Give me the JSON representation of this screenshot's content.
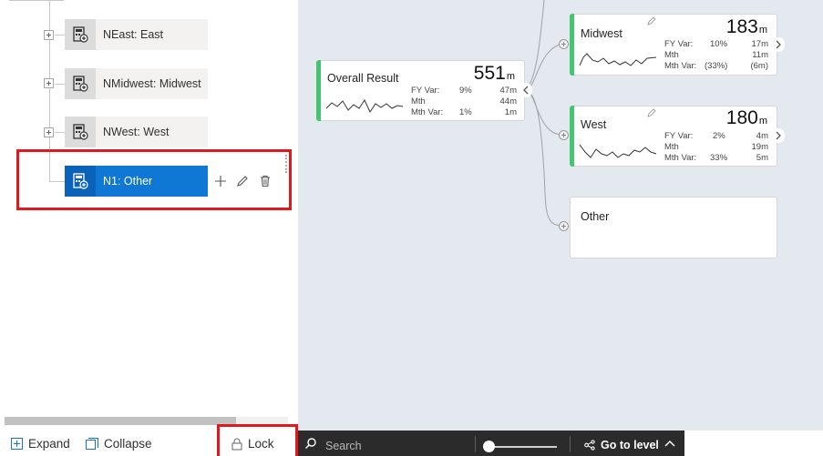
{
  "tree": {
    "nodes": [
      {
        "label": "NEast: East"
      },
      {
        "label": "NMidwest: Midwest"
      },
      {
        "label": "NWest: West"
      },
      {
        "label": "N1: Other",
        "selected": true
      }
    ],
    "actions": {
      "add": "add-icon",
      "edit": "pencil-icon",
      "delete": "trash-icon"
    }
  },
  "bottom": {
    "expand_label": "Expand",
    "collapse_label": "Collapse",
    "lock_label": "Lock"
  },
  "cards": {
    "overall": {
      "title": "Overall Result",
      "total": "551",
      "unit": "m",
      "rows": [
        {
          "label": "FY Var:",
          "pct": "9%",
          "val": "47m"
        },
        {
          "label": "Mth",
          "pct": "",
          "val": "44m"
        },
        {
          "label": "Mth Var:",
          "pct": "1%",
          "val": "1m"
        }
      ]
    },
    "midwest": {
      "title": "Midwest",
      "total": "183",
      "unit": "m",
      "rows": [
        {
          "label": "FY Var:",
          "pct": "10%",
          "val": "17m"
        },
        {
          "label": "Mth",
          "pct": "",
          "val": "11m"
        },
        {
          "label": "Mth Var:",
          "pct": "(33%)",
          "val": "(6m)"
        }
      ]
    },
    "west": {
      "title": "West",
      "total": "180",
      "unit": "m",
      "rows": [
        {
          "label": "FY Var:",
          "pct": "2%",
          "val": "4m"
        },
        {
          "label": "Mth",
          "pct": "",
          "val": "19m"
        },
        {
          "label": "Mth Var:",
          "pct": "33%",
          "val": "5m"
        }
      ]
    },
    "other": {
      "title": "Other"
    }
  },
  "toolbar": {
    "search_placeholder": "Search",
    "goto_level_label": "Go to level"
  },
  "colors": {
    "accent_green": "#43c66f",
    "selected_blue": "#0f78d4",
    "highlight_red": "#e0191f",
    "canvas_bg": "#e4e8ef",
    "toolbar_bg": "#2b2b2b"
  }
}
